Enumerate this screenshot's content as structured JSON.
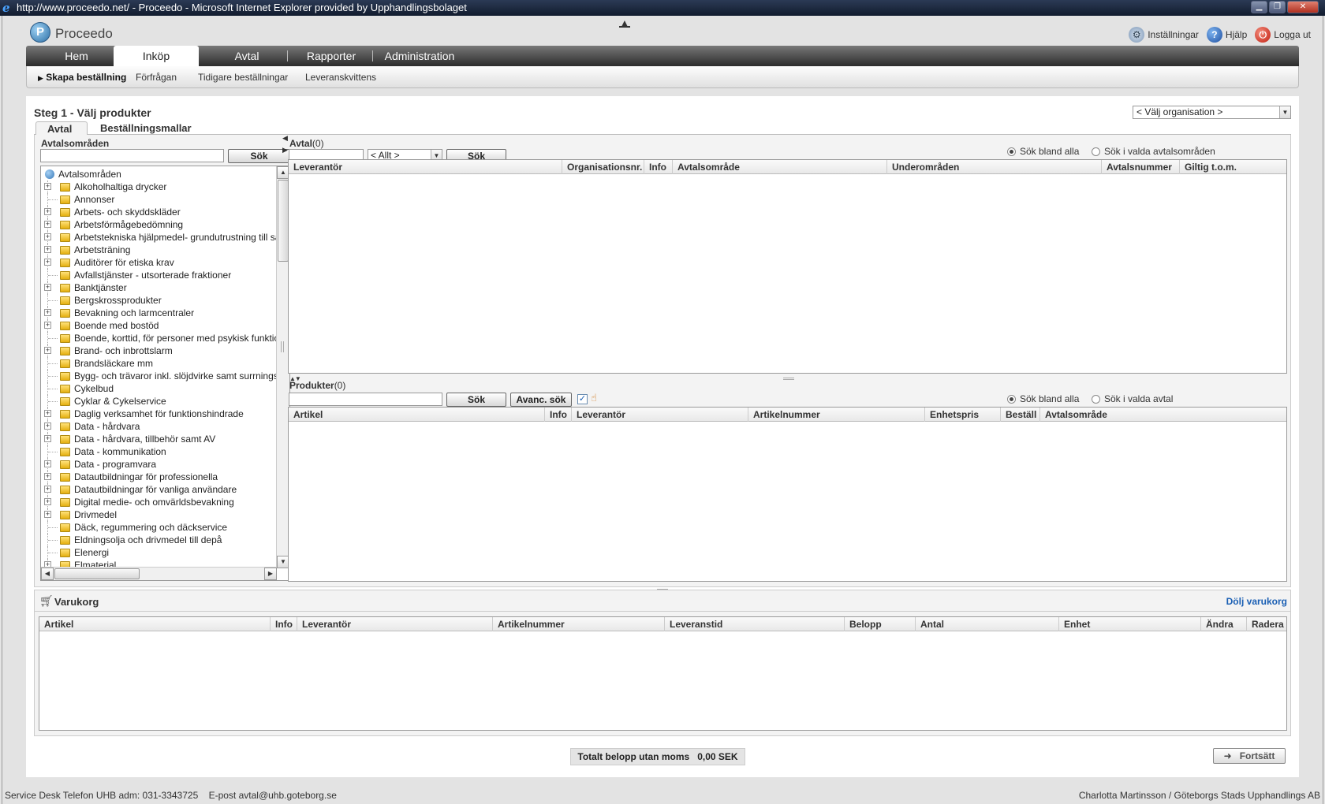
{
  "window": {
    "title": "http://www.proceedo.net/ - Proceedo - Microsoft Internet Explorer provided by Upphandlingsbolaget",
    "minimize": "▁",
    "restore": "❐",
    "close": "✕"
  },
  "app": {
    "logo_text": "Proceedo",
    "settings_label": "Inställningar",
    "help_label": "Hjälp",
    "logout_label": "Logga ut"
  },
  "nav": {
    "tabs": [
      {
        "label": "Hem"
      },
      {
        "label": "Inköp"
      },
      {
        "label": "Avtal"
      },
      {
        "label": "Rapporter"
      },
      {
        "label": "Administration"
      }
    ],
    "subtabs": [
      {
        "label": "Skapa beställning"
      },
      {
        "label": "Förfrågan"
      },
      {
        "label": "Tidigare beställningar"
      },
      {
        "label": "Leveranskvittens"
      }
    ]
  },
  "step": {
    "title": "Steg 1 - Välj produkter",
    "org_select": "< Välj organisation >"
  },
  "content_tabs": [
    "Avtal",
    "Beställningsmallar"
  ],
  "avtalsomraden": {
    "label": "Avtalsområden",
    "search_button": "Sök",
    "tree_root": "Avtalsområden",
    "items": [
      {
        "label": "Alkoholhaltiga drycker",
        "expandable": true
      },
      {
        "label": "Annonser",
        "expandable": false
      },
      {
        "label": "Arbets- och skyddskläder",
        "expandable": true
      },
      {
        "label": "Arbetsförmågebedömning",
        "expandable": true
      },
      {
        "label": "Arbetstekniska hjälpmedel- grundutrustning till särskilt",
        "expandable": true
      },
      {
        "label": "Arbetsträning",
        "expandable": true
      },
      {
        "label": "Auditörer för etiska krav",
        "expandable": true
      },
      {
        "label": "Avfallstjänster - utsorterade fraktioner",
        "expandable": false
      },
      {
        "label": "Banktjänster",
        "expandable": true
      },
      {
        "label": "Bergskrossprodukter",
        "expandable": false
      },
      {
        "label": "Bevakning och larmcentraler",
        "expandable": true
      },
      {
        "label": "Boende med bostöd",
        "expandable": true
      },
      {
        "label": "Boende, korttid, för personer med psykisk funktionsnedsättning",
        "expandable": false
      },
      {
        "label": "Brand- och inbrottslarm",
        "expandable": true
      },
      {
        "label": "Brandsläckare mm",
        "expandable": false
      },
      {
        "label": "Bygg- och trävaror inkl. slöjdvirke samt surrningsvirke",
        "expandable": false
      },
      {
        "label": "Cykelbud",
        "expandable": false
      },
      {
        "label": "Cyklar & Cykelservice",
        "expandable": false
      },
      {
        "label": "Daglig verksamhet för funktionshindrade",
        "expandable": true
      },
      {
        "label": "Data - hårdvara",
        "expandable": true
      },
      {
        "label": "Data - hårdvara, tillbehör samt AV",
        "expandable": true
      },
      {
        "label": "Data - kommunikation",
        "expandable": false
      },
      {
        "label": "Data - programvara",
        "expandable": true
      },
      {
        "label": "Datautbildningar för professionella",
        "expandable": true
      },
      {
        "label": "Datautbildningar för vanliga användare",
        "expandable": true
      },
      {
        "label": "Digital medie- och omvärldsbevakning",
        "expandable": true
      },
      {
        "label": "Drivmedel",
        "expandable": true
      },
      {
        "label": "Däck, regummering och däckservice",
        "expandable": false
      },
      {
        "label": "Eldningsolja och drivmedel till depå",
        "expandable": false
      },
      {
        "label": "Elenergi",
        "expandable": false
      },
      {
        "label": "Elmaterial",
        "expandable": true
      }
    ]
  },
  "avtal": {
    "label": "Avtal",
    "count": "(0)",
    "filter_select": "< Allt >",
    "search_button": "Sök",
    "radio_all": "Sök bland alla",
    "radio_selected": "Sök i valda avtalsområden",
    "columns": [
      "Leverantör",
      "Organisationsnr.",
      "Info",
      "Avtalsområde",
      "Underområden",
      "Avtalsnummer",
      "Giltig t.o.m."
    ]
  },
  "produkter": {
    "label": "Produkter",
    "count": "(0)",
    "search_button": "Sök",
    "advanced_button": "Avanc. sök",
    "radio_all": "Sök bland alla",
    "radio_selected": "Sök i valda avtal",
    "columns": [
      "Artikel",
      "Info",
      "Leverantör",
      "Artikelnummer",
      "Enhetspris",
      "Beställ",
      "Avtalsområde"
    ]
  },
  "varukorg": {
    "title": "Varukorg",
    "hide_link": "Dölj varukorg",
    "columns": [
      "Artikel",
      "Info",
      "Leverantör",
      "Artikelnummer",
      "Leveranstid",
      "Belopp",
      "Antal",
      "Enhet",
      "Ändra",
      "Radera"
    ]
  },
  "total": {
    "label": "Totalt belopp utan moms",
    "value": "0,00 SEK"
  },
  "continue_button": "Fortsätt",
  "footer": {
    "left": "Service Desk Telefon UHB adm: 031-3343725    E-post avtal@uhb.goteborg.se",
    "right": "Charlotta Martinsson / Göteborgs Stads Upphandlings AB"
  },
  "colors": {
    "nav_dark": "#2c2c2c",
    "link_blue": "#1a5fb4",
    "logout_red": "#d9281c"
  }
}
